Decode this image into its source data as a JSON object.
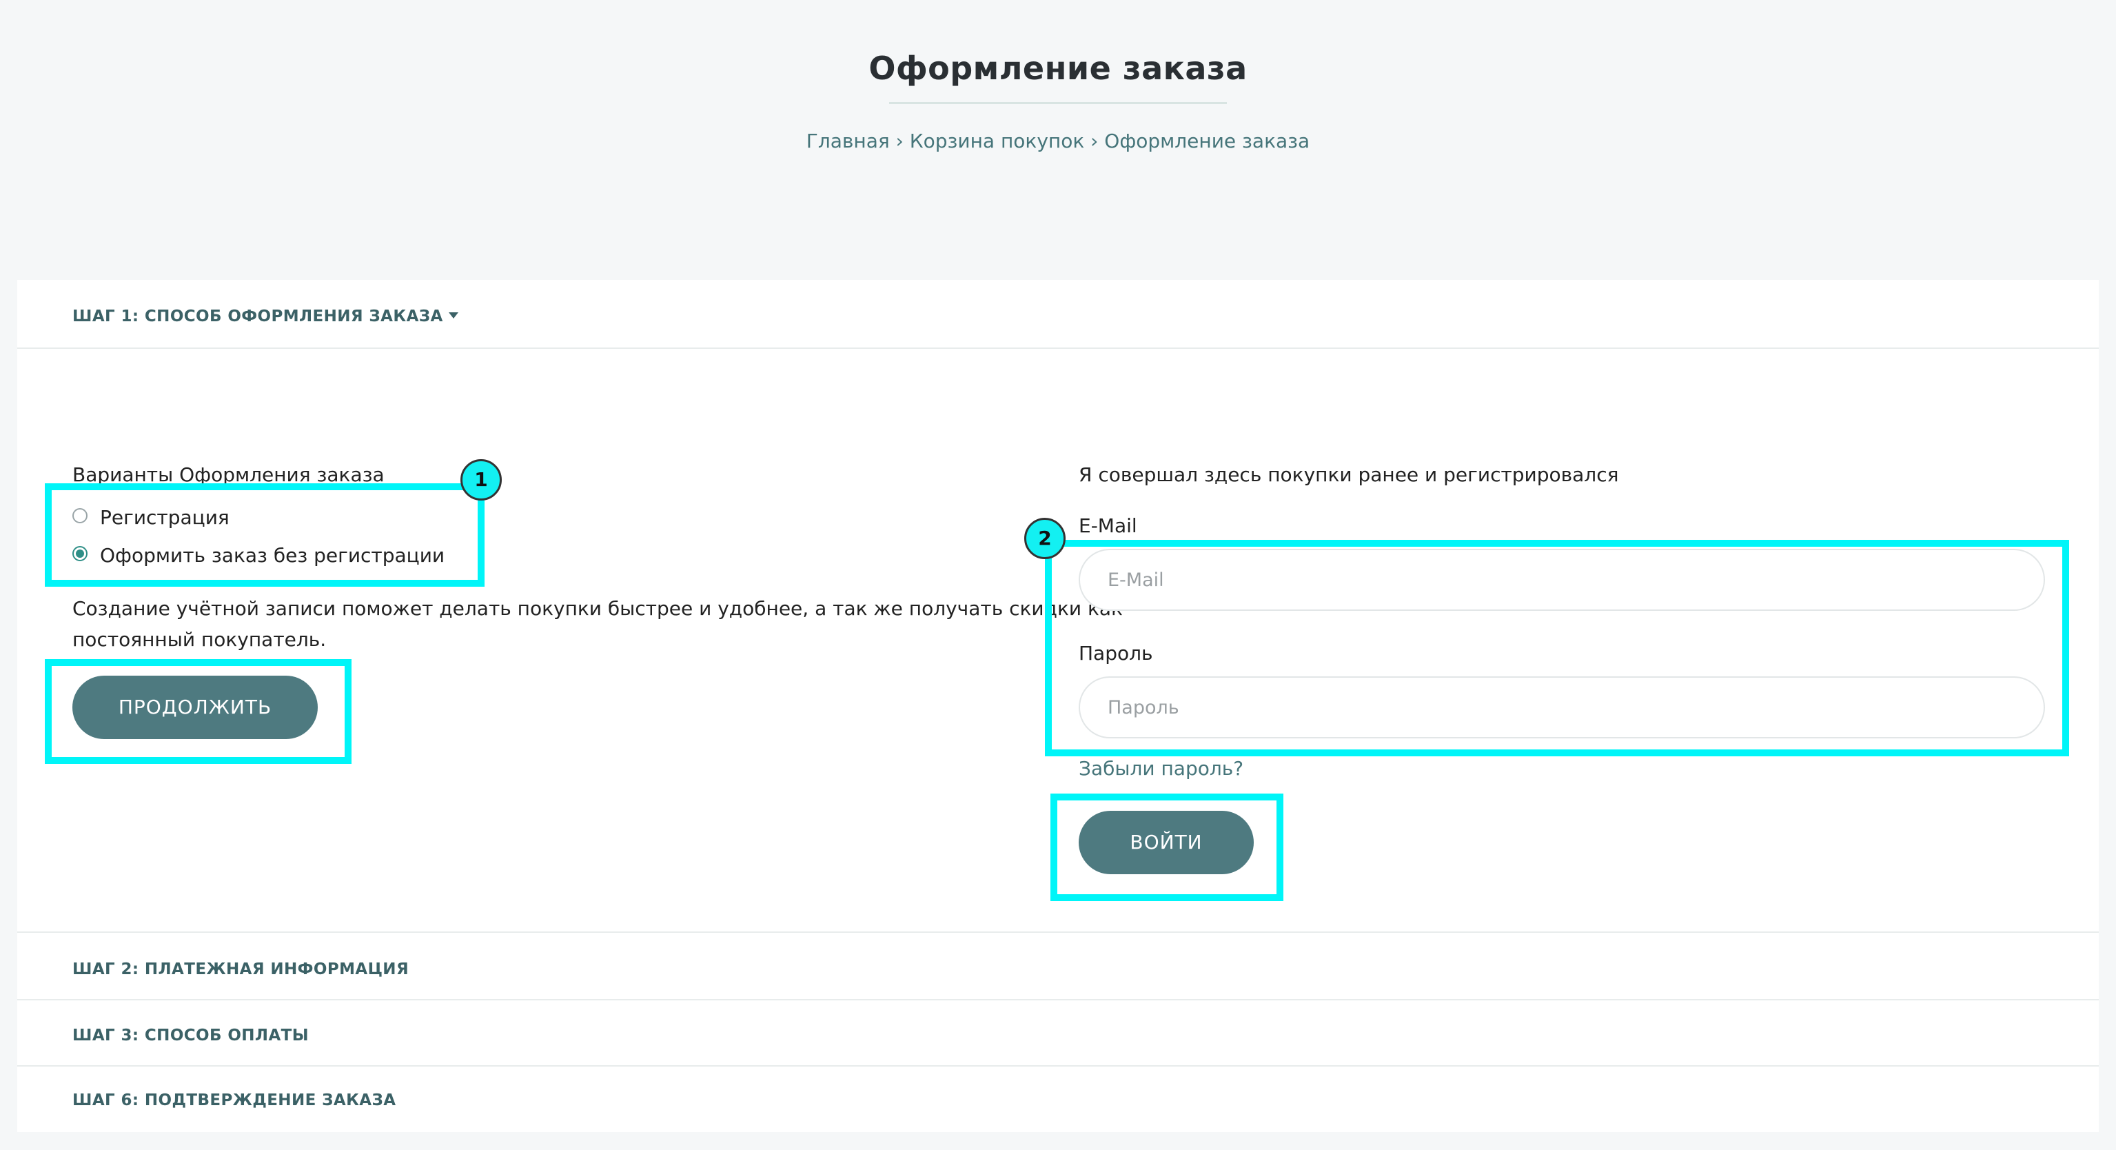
{
  "page": {
    "title": "Оформление заказа",
    "breadcrumb": [
      "Главная",
      "Корзина покупок",
      "Оформление заказа"
    ],
    "breadcrumb_separator": "›"
  },
  "steps": {
    "step1_label": "ШАГ 1: СПОСОБ ОФОРМЛЕНИЯ ЗАКАЗА",
    "step2_label": "ШАГ 2: ПЛАТЕЖНАЯ ИНФОРМАЦИЯ",
    "step3_label": "ШАГ 3: СПОСОБ ОПЛАТЫ",
    "step6_label": "ШАГ 6: ПОДТВЕРЖДЕНИЕ ЗАКАЗА"
  },
  "checkout_options": {
    "heading": "Варианты Оформления заказа",
    "options": [
      {
        "label": "Регистрация",
        "selected": false
      },
      {
        "label": "Оформить заказ без регистрации",
        "selected": true
      }
    ],
    "description_line1": "Создание учётной записи поможет делать покупки быстрее и удобнее, а так же получать скидки как",
    "description_line2": "постоянный покупатель.",
    "continue_label": "ПРОДОЛЖИТЬ"
  },
  "login": {
    "heading": "Я совершал здесь покупки ранее и регистрировался",
    "email_label": "E-Mail",
    "email_placeholder": "E-Mail",
    "password_label": "Пароль",
    "password_placeholder": "Пароль",
    "forgot_label": "Забыли пароль?",
    "login_label": "ВОЙТИ"
  },
  "annotations": {
    "marker1": "1",
    "marker2": "2",
    "highlight_color": "#00f5f8"
  },
  "colors": {
    "button": "#4e7a80",
    "step_text": "#3b6166",
    "link": "#46757a",
    "radio_checked": "#2f8f87",
    "background": "#f5f7f8"
  }
}
